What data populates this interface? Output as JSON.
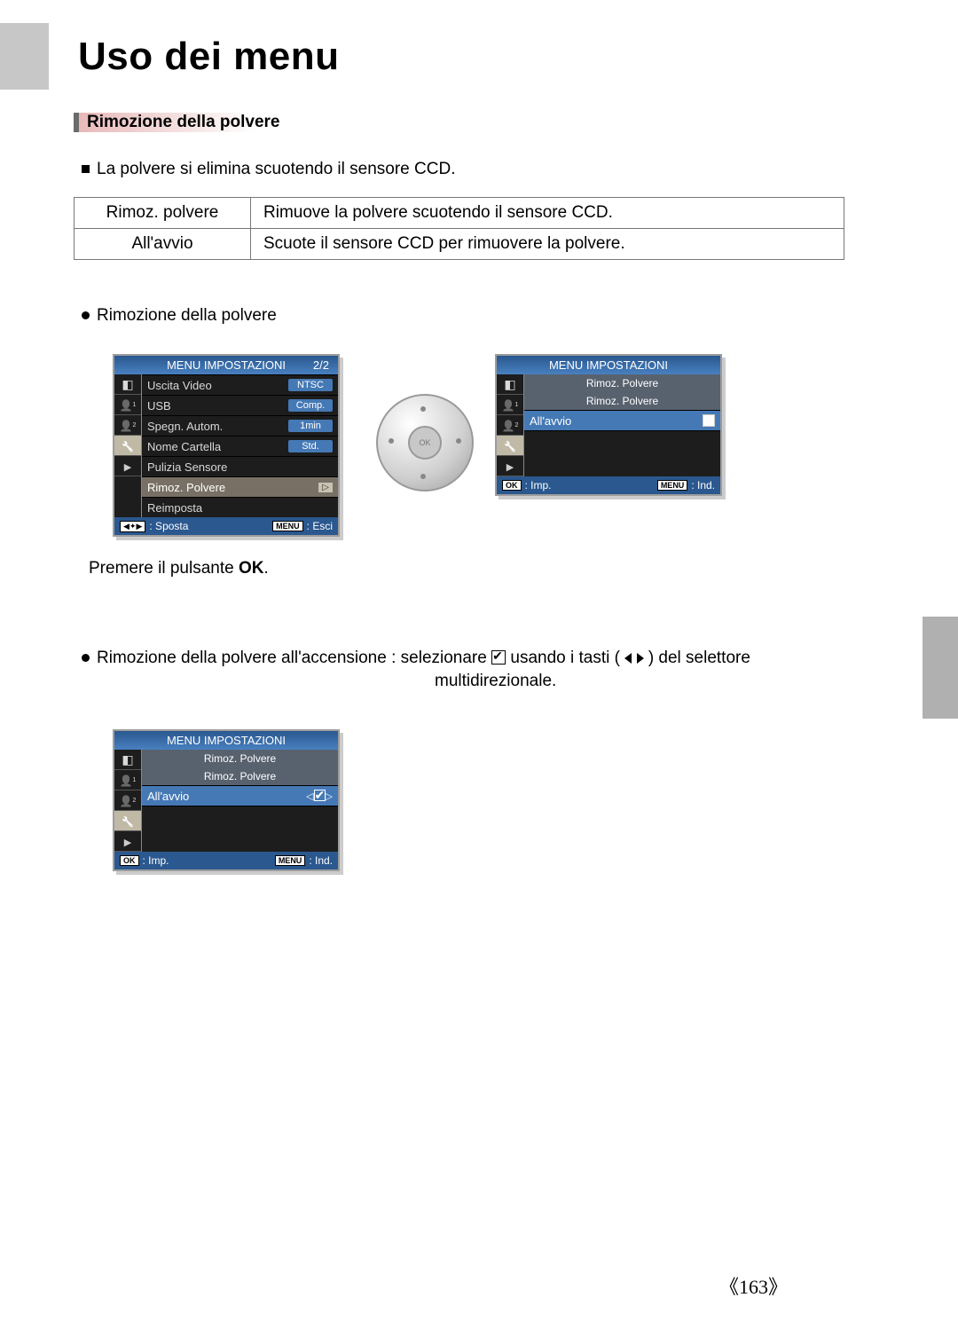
{
  "page_title": "Uso dei menu",
  "section_heading": "Rimozione della polvere",
  "intro_bullet": "La polvere si elimina scuotendo il sensore CCD.",
  "table": {
    "r1c1": "Rimoz. polvere",
    "r1c2": "Rimuove la polvere scuotendo il sensore CCD.",
    "r2c1": "All'avvio",
    "r2c2": "Scuote il sensore CCD per rimuovere la polvere."
  },
  "sub_bullet_1": "Rimozione della polvere",
  "lcd1": {
    "hdr": "MENU IMPOSTAZIONI",
    "page": "2/2",
    "rows": [
      {
        "label": "Uscita Video",
        "val": "NTSC"
      },
      {
        "label": "USB",
        "val": "Comp."
      },
      {
        "label": "Spegn. Autom.",
        "val": "1min"
      },
      {
        "label": "Nome Cartella",
        "val": "Std."
      },
      {
        "label": "Pulizia Sensore",
        "val": ""
      },
      {
        "label": "Rimoz. Polvere",
        "val": "▷",
        "hl": true
      },
      {
        "label": "Reimposta",
        "val": ""
      }
    ],
    "ftr_left": ": Sposta",
    "ftr_right": ": Esci"
  },
  "dial_center": "OK",
  "lcd2": {
    "hdr": "MENU IMPOSTAZIONI",
    "sub1": "Rimoz. Polvere",
    "sub2": "Rimoz. Polvere",
    "row_label": "All'avvio",
    "row_val": "☐",
    "ftr_left": ": Imp.",
    "ftr_right": ": Ind."
  },
  "press_ok_pre": "Premere il pulsante ",
  "press_ok_bold": "OK",
  "press_ok_post": ".",
  "sub_bullet_2_pre": "Rimozione della polvere all'accensione : selezionare ",
  "sub_bullet_2_mid": " usando i tasti (",
  "sub_bullet_2_post": ") del selettore",
  "sub_bullet_2_line2": "multidirezionale.",
  "lcd3": {
    "hdr": "MENU IMPOSTAZIONI",
    "sub1": "Rimoz. Polvere",
    "sub2": "Rimoz. Polvere",
    "row_label": "All'avvio",
    "ftr_left": ": Imp.",
    "ftr_right": ": Ind."
  },
  "page_number": "163",
  "icons": {
    "ok": "OK",
    "menu": "MENU",
    "nav": "◀✦▶"
  }
}
